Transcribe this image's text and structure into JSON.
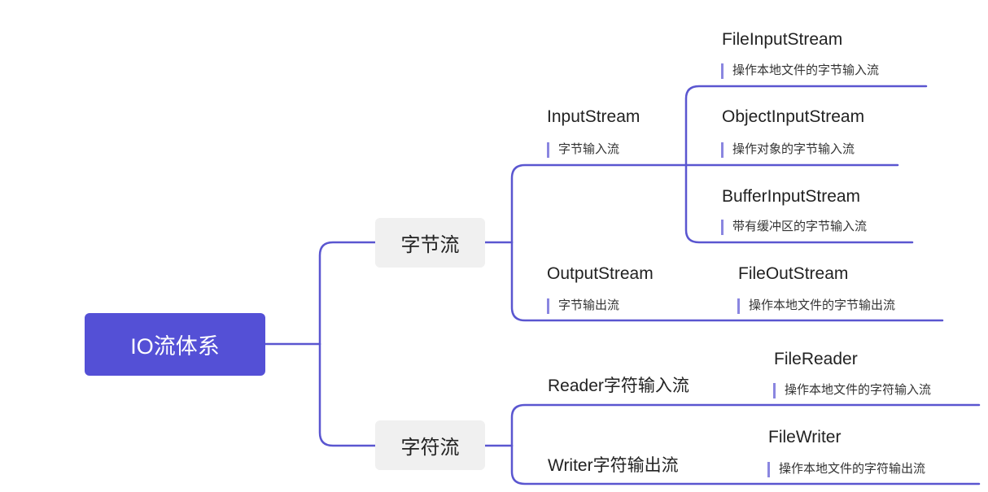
{
  "root": {
    "label": "IO流体系"
  },
  "branches": [
    {
      "label": "字节流"
    },
    {
      "label": "字符流"
    }
  ],
  "byte_stream": {
    "input": {
      "title": "InputStream",
      "note": "字节输入流"
    },
    "output": {
      "title": "OutputStream",
      "note": "字节输出流"
    },
    "input_children": [
      {
        "title": "FileInputStream",
        "note": "操作本地文件的字节输入流"
      },
      {
        "title": "ObjectInputStream",
        "note": "操作对象的字节输入流"
      },
      {
        "title": "BufferInputStream",
        "note": "带有缓冲区的字节输入流"
      }
    ],
    "output_children": [
      {
        "title": "FileOutStream",
        "note": "操作本地文件的字节输出流"
      }
    ]
  },
  "char_stream": {
    "reader": {
      "title": "Reader字符输入流"
    },
    "writer": {
      "title": "Writer字符输出流"
    },
    "reader_children": [
      {
        "title": "FileReader",
        "note": "操作本地文件的字符输入流"
      }
    ],
    "writer_children": [
      {
        "title": "FileWriter",
        "note": "操作本地文件的字符输出流"
      }
    ]
  },
  "colors": {
    "accent": "#5450d6",
    "line": "#5a56d0",
    "branch_bg": "#f0f0f0"
  }
}
